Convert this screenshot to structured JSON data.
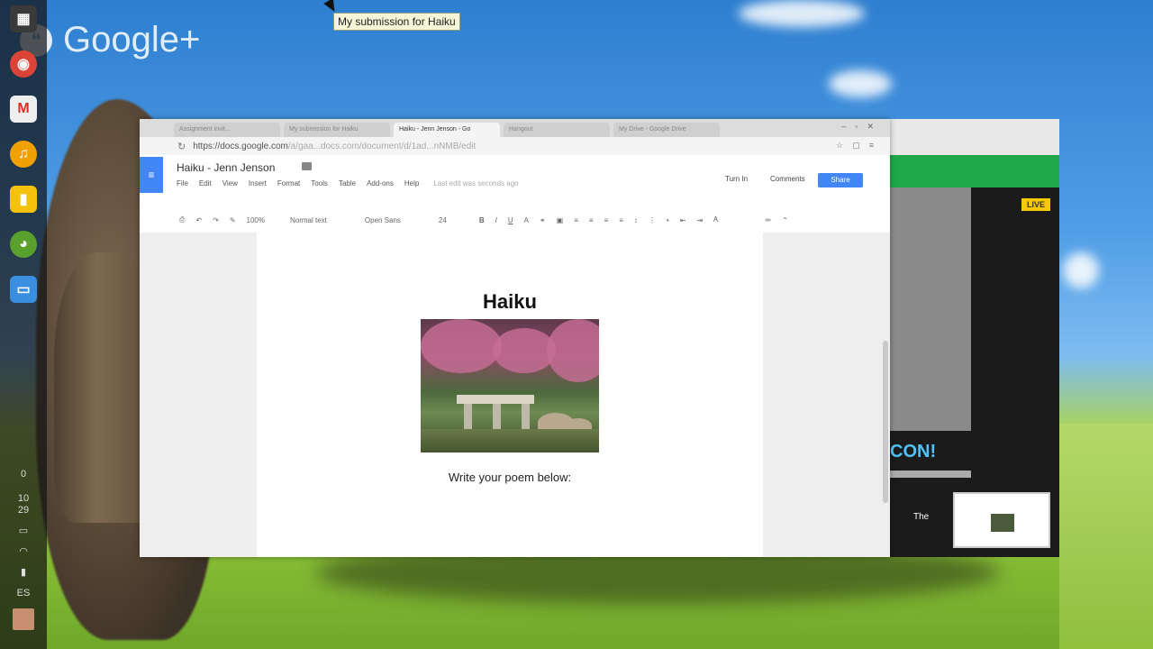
{
  "desktop": {
    "watermark": "Google+",
    "tooltip": "My submission for Haiku"
  },
  "shelf": {
    "apps": [
      {
        "name": "apps-launcher-icon",
        "glyph": "▦",
        "color": "#3a3a3a"
      },
      {
        "name": "chrome-icon",
        "glyph": "◉",
        "color": "#db4437"
      },
      {
        "name": "gmail-icon",
        "glyph": "M",
        "color": "#d93025"
      },
      {
        "name": "headphones-icon",
        "glyph": "♫",
        "color": "#f0a000"
      },
      {
        "name": "keep-icon",
        "glyph": "▮",
        "color": "#f4c20d"
      },
      {
        "name": "owl-icon",
        "glyph": "◕",
        "color": "#5aa02c"
      },
      {
        "name": "files-icon",
        "glyph": "▭",
        "color": "#3b8fe0"
      }
    ],
    "status": {
      "notifications": "0",
      "time_hour": "10",
      "time_min": "29",
      "language": "ES"
    }
  },
  "browser": {
    "tabs": [
      {
        "label": "Assignment invit..."
      },
      {
        "label": "My submission for Haiku"
      },
      {
        "label": "Haiku - Jenn Jenson - Go"
      },
      {
        "label": "Hangout"
      },
      {
        "label": "My Drive - Google Drive"
      }
    ],
    "url_host": "https://docs.google.com",
    "url_path": "/a/gaa...docs.com/document/d/1ad...nNMB/edit"
  },
  "docs": {
    "title": "Haiku - Jenn Jenson",
    "menu": [
      "File",
      "Edit",
      "View",
      "Insert",
      "Format",
      "Tools",
      "Table",
      "Add-ons",
      "Help"
    ],
    "save_status": "Last edit was seconds ago",
    "turn_in": "Turn In",
    "comments": "Comments",
    "share": "Share",
    "toolbar": {
      "zoom": "100%",
      "style": "Normal text",
      "font": "Open Sans",
      "size": "24"
    },
    "content": {
      "heading": "Haiku",
      "prompt": "Write your poem below:"
    }
  },
  "hangout": {
    "live": "LIVE",
    "banner": "CON!",
    "caption": "The"
  }
}
